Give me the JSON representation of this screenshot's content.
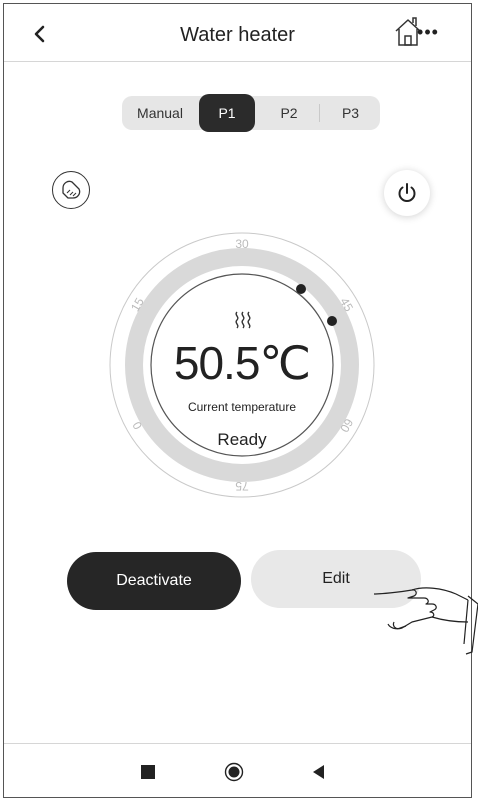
{
  "header": {
    "title": "Water heater",
    "back_icon": "chevron-left-icon",
    "home_icon": "home-icon",
    "more_label": "•••"
  },
  "mode_tabs": [
    {
      "label": "Manual",
      "selected": false
    },
    {
      "label": "P1",
      "selected": true
    },
    {
      "label": "P2",
      "selected": false
    },
    {
      "label": "P3",
      "selected": false
    }
  ],
  "controls": {
    "boost_icon": "boost-icon",
    "power_icon": "power-icon"
  },
  "dial": {
    "scale_labels": [
      "0",
      "15",
      "30",
      "45",
      "60",
      "75"
    ],
    "temperature": "50.5℃",
    "temperature_value": 50.5,
    "unit": "°C",
    "label": "Current temperature",
    "status": "Ready",
    "heat_icon": "heat-waves-icon"
  },
  "actions": {
    "deactivate_label": "Deactivate",
    "edit_label": "Edit"
  },
  "nav": {
    "recent_icon": "square-icon",
    "home_icon": "circle-icon",
    "back_icon": "triangle-back-icon"
  },
  "colors": {
    "dark": "#262626",
    "light_button": "#e8e8e8",
    "ring": "#d9d9d9",
    "background": "#ffffff"
  }
}
